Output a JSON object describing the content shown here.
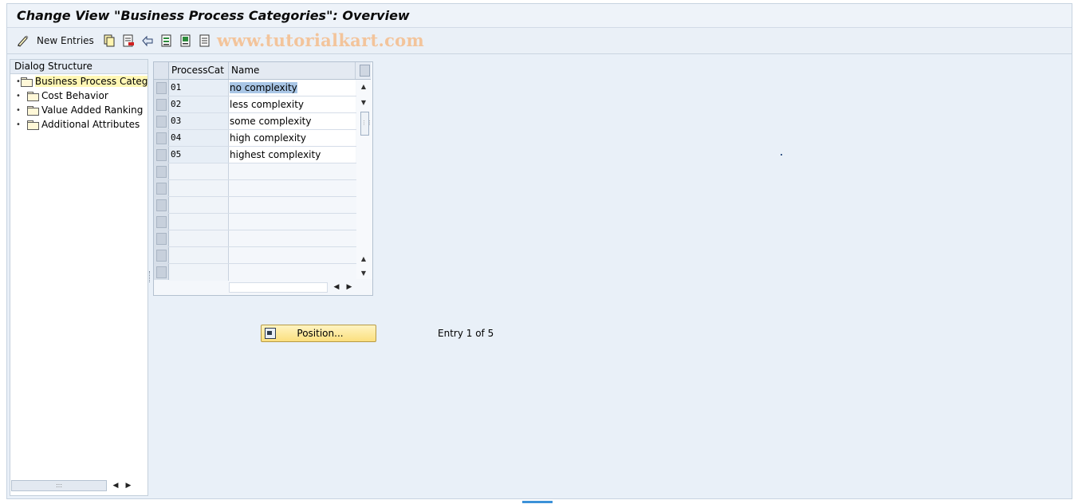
{
  "window": {
    "title": "Change View \"Business Process Categories\": Overview"
  },
  "toolbar": {
    "new_entries_label": "New Entries",
    "watermark": "www.tutorialkart.com",
    "icons": [
      "edit-pen-icon",
      "copy-icon",
      "delete-icon",
      "undo-icon",
      "select-all-icon",
      "select-block-icon",
      "deselect-all-icon"
    ]
  },
  "dialog_structure": {
    "header": "Dialog Structure",
    "items": [
      {
        "label": "Business Process Catego",
        "selected": true,
        "icon": "folder-open-icon"
      },
      {
        "label": "Cost Behavior",
        "selected": false,
        "icon": "folder-icon"
      },
      {
        "label": "Value Added Ranking",
        "selected": false,
        "icon": "folder-icon"
      },
      {
        "label": "Additional Attributes",
        "selected": false,
        "icon": "folder-icon"
      }
    ]
  },
  "table": {
    "columns": [
      "ProcessCat",
      "Name"
    ],
    "rows": [
      {
        "code": "01",
        "name": "no complexity"
      },
      {
        "code": "02",
        "name": "less complexity"
      },
      {
        "code": "03",
        "name": "some complexity"
      },
      {
        "code": "04",
        "name": "high complexity"
      },
      {
        "code": "05",
        "name": "highest complexity"
      }
    ]
  },
  "footer": {
    "position_button_label": "Position...",
    "entry_info": "Entry 1 of 5"
  },
  "colors": {
    "background": "#e9f0f8",
    "button_yellow": "#fbdf7e",
    "selection_highlight": "#a9c6e6",
    "watermark": "#f3c49b"
  }
}
